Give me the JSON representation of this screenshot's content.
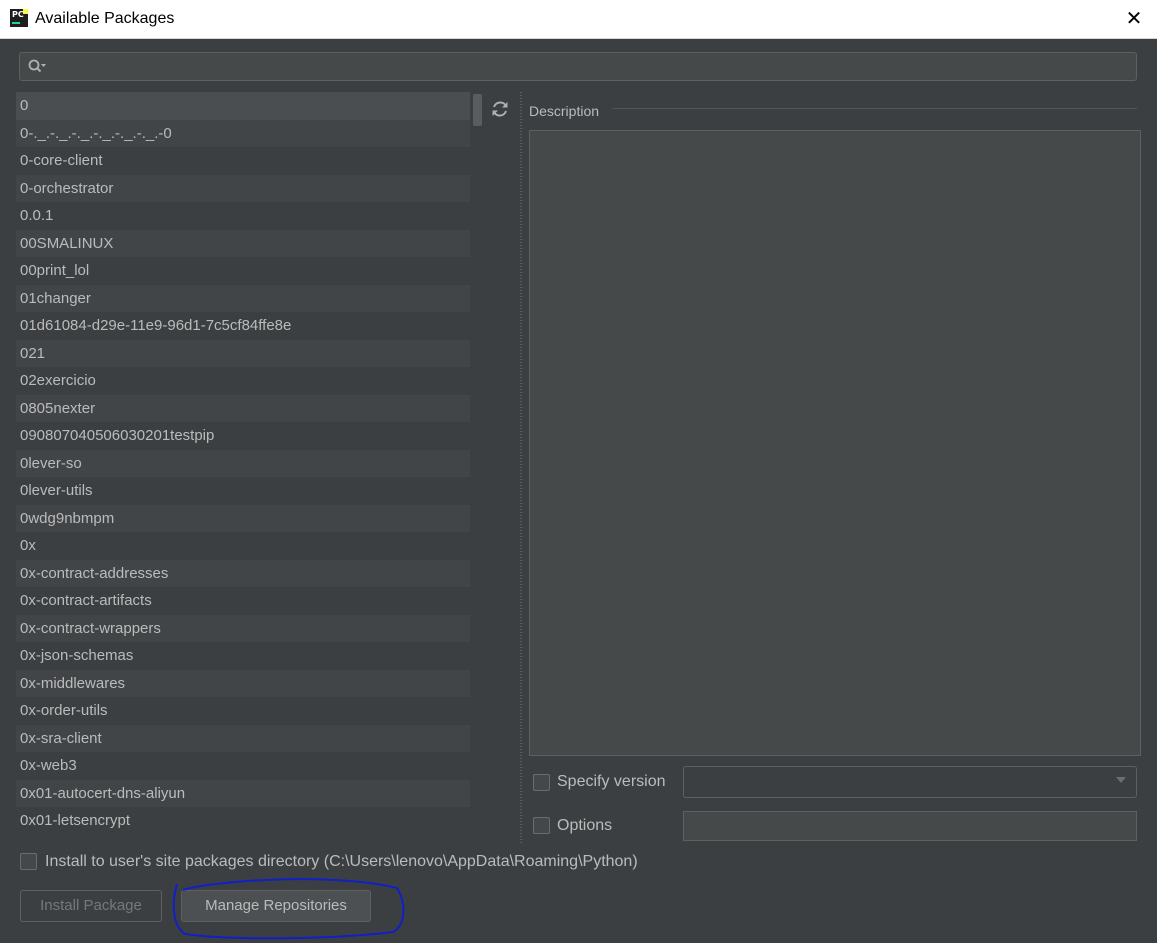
{
  "window": {
    "title": "Available Packages",
    "close_symbol": "✕"
  },
  "search": {
    "value": ""
  },
  "packages": [
    "0",
    "0-._.-._.-._.-._.-._.-._.-0",
    "0-core-client",
    "0-orchestrator",
    "0.0.1",
    "00SMALINUX",
    "00print_lol",
    "01changer",
    "01d61084-d29e-11e9-96d1-7c5cf84ffe8e",
    "021",
    "02exercicio",
    "0805nexter",
    "090807040506030201testpip",
    "0lever-so",
    "0lever-utils",
    "0wdg9nbmpm",
    "0x",
    "0x-contract-addresses",
    "0x-contract-artifacts",
    "0x-contract-wrappers",
    "0x-json-schemas",
    "0x-middlewares",
    "0x-order-utils",
    "0x-sra-client",
    "0x-web3",
    "0x01-autocert-dns-aliyun",
    "0x01-letsencrypt"
  ],
  "description": {
    "label": "Description",
    "text": ""
  },
  "specify_version": {
    "label": "Specify version",
    "checked": false,
    "value": ""
  },
  "options": {
    "label": "Options",
    "checked": false,
    "value": ""
  },
  "install_user": {
    "label": "Install to user's site packages directory (C:\\Users\\lenovo\\AppData\\Roaming\\Python)",
    "checked": false
  },
  "buttons": {
    "install": "Install Package",
    "manage": "Manage Repositories"
  },
  "colors": {
    "background": "#3c3f41",
    "annotation_stroke": "#1020c8"
  }
}
